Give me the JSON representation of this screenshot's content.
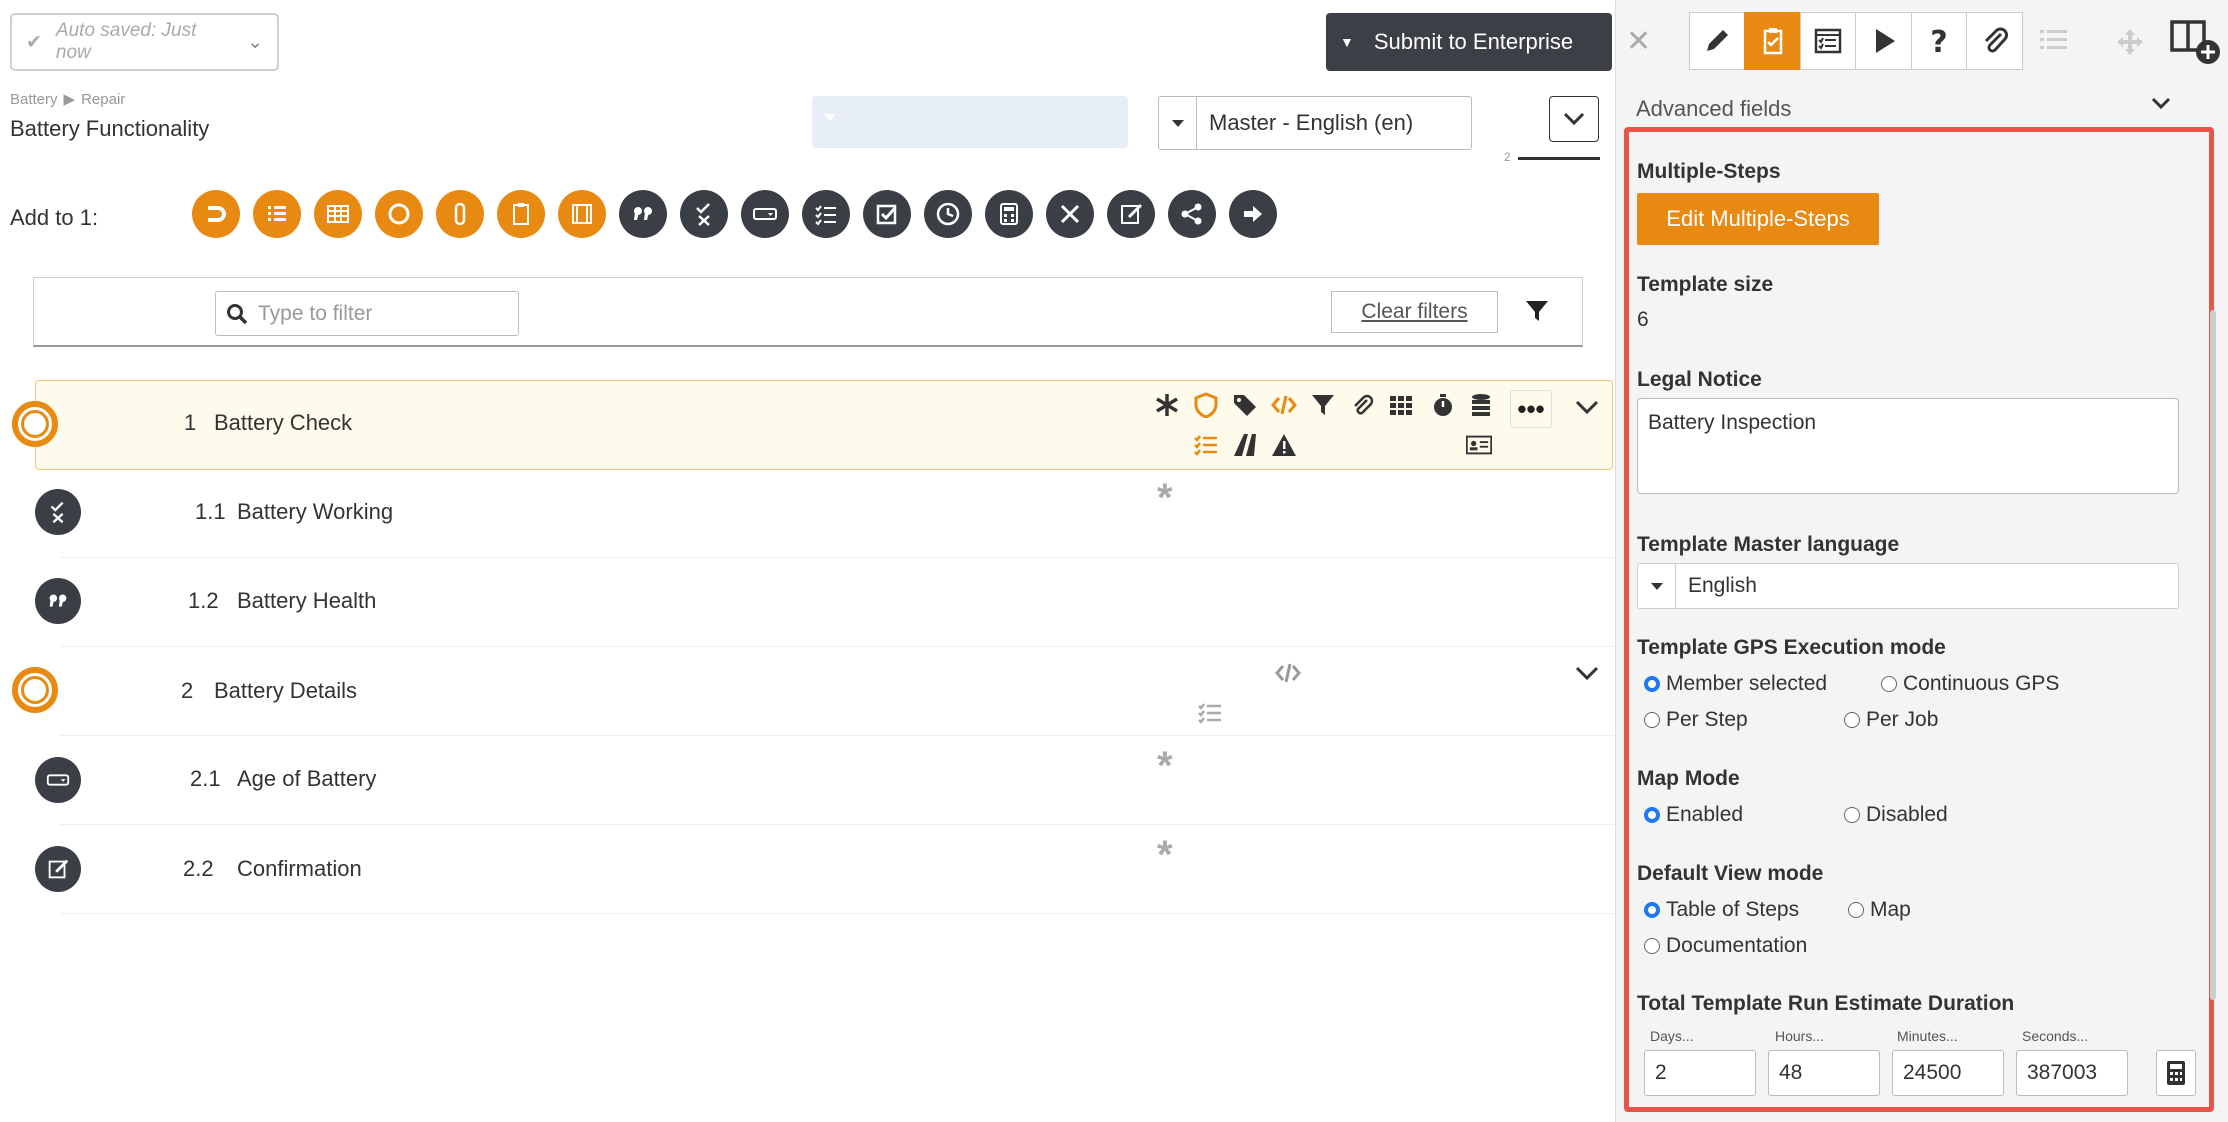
{
  "header": {
    "autosave_text": "Auto saved: Just now",
    "submit_label": "Submit to Enterprise"
  },
  "breadcrumb": [
    "Battery",
    "Repair"
  ],
  "page_title": "Battery Functionality",
  "language_select": "Master - English (en)",
  "page_indicator": "2",
  "add_to_label": "Add to 1:",
  "toolbar_icons": [
    "half-circle-icon",
    "numbered-list-icon",
    "table-icon",
    "circle-icon",
    "attachment-link-icon",
    "checklist-clipboard-icon",
    "film-icon",
    "quote-icon",
    "check-x-icon",
    "dropdown-field-icon",
    "check-list-icon",
    "checkbox-icon",
    "clock-icon",
    "calculator-icon",
    "pencil-ruler-icon",
    "signature-icon",
    "share-icon",
    "arrow-right-icon"
  ],
  "filter": {
    "placeholder": "Type to filter",
    "clear_label": "Clear filters"
  },
  "steps": [
    {
      "num": "1",
      "name": "Battery Check",
      "icon": "circle-ring-icon",
      "selected": true
    },
    {
      "num": "1.1",
      "name": "Battery Working",
      "icon": "check-x-icon"
    },
    {
      "num": "1.2",
      "name": "Battery Health",
      "icon": "quote-icon"
    },
    {
      "num": "2",
      "name": "Battery Details",
      "icon": "circle-ring-icon"
    },
    {
      "num": "2.1",
      "name": "Age of Battery",
      "icon": "dropdown-field-icon"
    },
    {
      "num": "2.2",
      "name": "Confirmation",
      "icon": "signature-icon"
    }
  ],
  "right_panel": {
    "section_title": "Advanced fields",
    "multiple_steps_label": "Multiple-Steps",
    "edit_multiple_steps_label": "Edit Multiple-Steps",
    "template_size_label": "Template size",
    "template_size_value": "6",
    "legal_notice_label": "Legal Notice",
    "legal_notice_value": "Battery Inspection",
    "master_language_label": "Template Master language",
    "master_language_value": "English",
    "gps_label": "Template GPS Execution mode",
    "gps_options": [
      "Member selected",
      "Continuous GPS",
      "Per Step",
      "Per Job"
    ],
    "gps_selected": "Member selected",
    "map_mode_label": "Map Mode",
    "map_mode_options": [
      "Enabled",
      "Disabled"
    ],
    "map_mode_selected": "Enabled",
    "view_mode_label": "Default View mode",
    "view_mode_options": [
      "Table of Steps",
      "Map",
      "Documentation"
    ],
    "view_mode_selected": "Table of Steps",
    "duration_label": "Total Template Run Estimate Duration",
    "duration_fields": [
      {
        "label": "Days...",
        "value": "2"
      },
      {
        "label": "Hours...",
        "value": "48"
      },
      {
        "label": "Minutes...",
        "value": "24500"
      },
      {
        "label": "Seconds...",
        "value": "387003"
      }
    ]
  },
  "colors": {
    "accent": "#e88a12",
    "dark": "#3a3f46",
    "highlight_border": "#e85446",
    "radio_on": "#1e78f0"
  }
}
